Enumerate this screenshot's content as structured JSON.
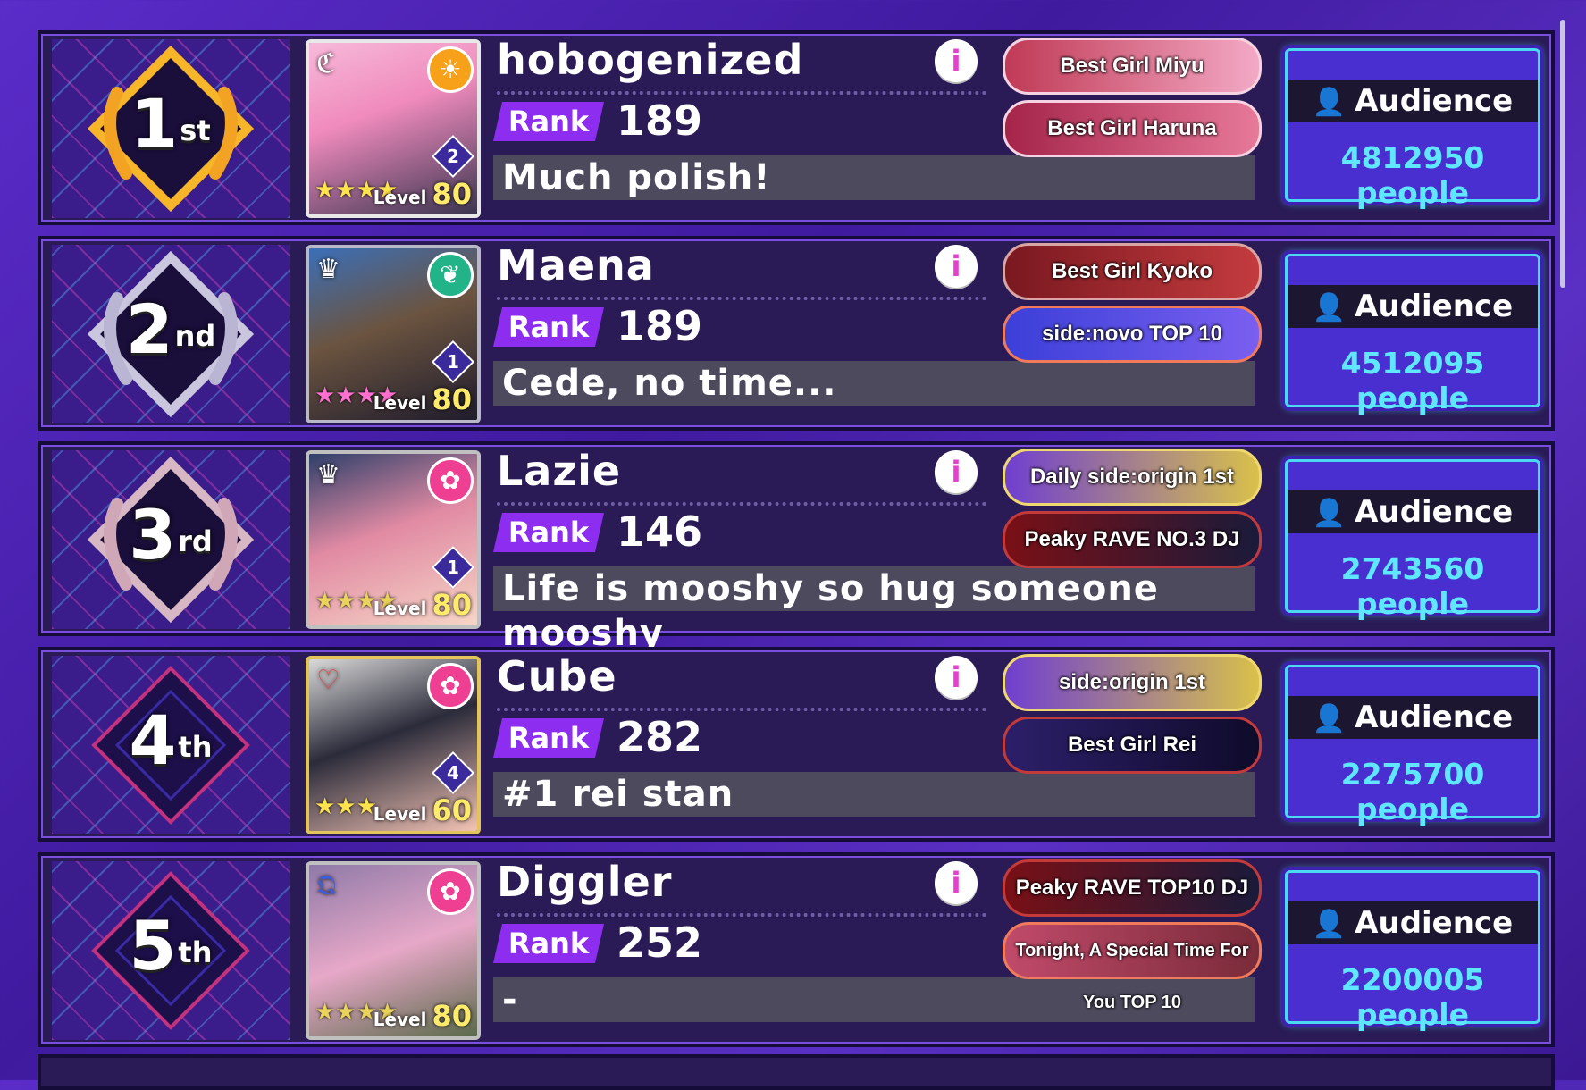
{
  "colors": {
    "rank_label_bg": "#8d2df0",
    "audience_count": "#5fe7ff",
    "audience_border": "#4cd8f0",
    "row_bg": "#2a1a55",
    "comment_bg": "#4e4a5e"
  },
  "common": {
    "rank_label": "Rank",
    "level_label": "Level",
    "audience_label": "Audience",
    "info_glyph": "i"
  },
  "entries": [
    {
      "place_num": "1",
      "place_suffix": "st",
      "medal": "gold",
      "name": "hobogenized",
      "rank": "189",
      "comment": "Much polish!",
      "card": {
        "level": "80",
        "attribute_icon": "sun-icon",
        "trained": "2"
      },
      "titles": [
        "Best Girl Miyu",
        "Best Girl Haruna"
      ],
      "audience": "4812950 people"
    },
    {
      "place_num": "2",
      "place_suffix": "nd",
      "medal": "silver",
      "name": "Maena",
      "rank": "189",
      "comment": "Cede, no time...",
      "card": {
        "level": "80",
        "attribute_icon": "leaf-icon",
        "trained": "1"
      },
      "titles": [
        "Best Girl Kyoko",
        "side:novo TOP 10"
      ],
      "audience": "4512095 people"
    },
    {
      "place_num": "3",
      "place_suffix": "rd",
      "medal": "bronze",
      "name": "Lazie",
      "rank": "146",
      "comment": "Life is mooshy so hug someone mooshy",
      "card": {
        "level": "80",
        "attribute_icon": "ribbon-icon",
        "trained": "1"
      },
      "titles": [
        "Daily side:origin 1st",
        "Peaky RAVE NO.3 DJ"
      ],
      "audience": "2743560 people"
    },
    {
      "place_num": "4",
      "place_suffix": "th",
      "medal": "plain",
      "name": "Cube",
      "rank": "282",
      "comment": "#1 rei stan",
      "card": {
        "level": "60",
        "attribute_icon": "ribbon-icon",
        "trained": "4"
      },
      "titles": [
        "side:origin 1st",
        "Best Girl Rei"
      ],
      "audience": "2275700 people"
    },
    {
      "place_num": "5",
      "place_suffix": "th",
      "medal": "plain",
      "name": "Diggler",
      "rank": "252",
      "comment": "-",
      "card": {
        "level": "80",
        "attribute_icon": "ribbon-icon",
        "trained": ""
      },
      "titles": [
        "Peaky RAVE TOP10 DJ",
        "Tonight, A Special Time For You TOP 10"
      ],
      "audience": "2200005 people"
    }
  ]
}
